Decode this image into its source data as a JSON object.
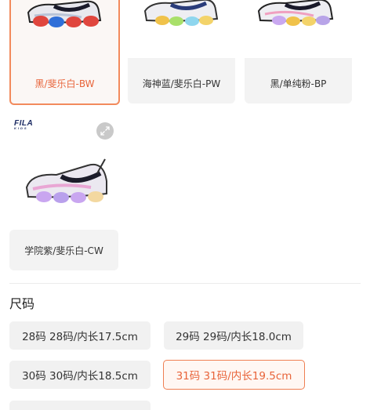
{
  "colors": [
    {
      "label": "黑/斐乐白-BW",
      "selected": true
    },
    {
      "label": "海神蓝/斐乐白-PW",
      "selected": false
    },
    {
      "label": "黑/单纯粉-BP",
      "selected": false
    },
    {
      "label": "学院紫/斐乐白-CW",
      "selected": false
    }
  ],
  "brand_logo": {
    "text": "FILA",
    "subtext": "KIDS"
  },
  "size_section": {
    "title": "尺码",
    "sizes": [
      {
        "label": "28码 28码/内长17.5cm",
        "selected": false
      },
      {
        "label": "29码 29码/内长18.0cm",
        "selected": false
      },
      {
        "label": "30码 30码/内长18.5cm",
        "selected": false
      },
      {
        "label": "31码 31码/内长19.5cm",
        "selected": true
      }
    ]
  },
  "accent_color": "#ef7f52"
}
